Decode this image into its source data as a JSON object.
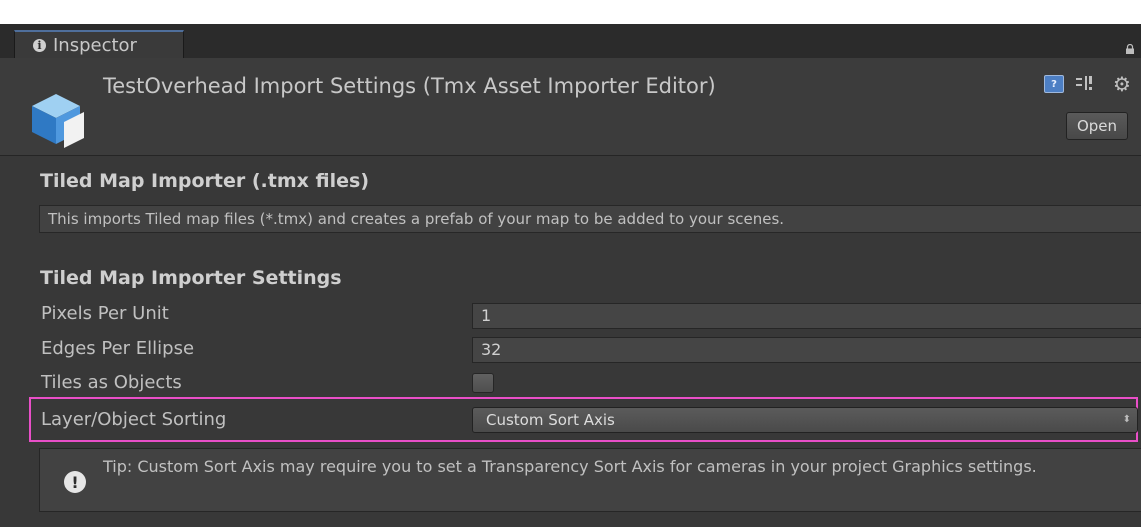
{
  "tab": {
    "label": "Inspector",
    "info_icon": "i"
  },
  "header": {
    "title": "TestOverhead Import Settings (Tmx Asset Importer Editor)",
    "open_label": "Open",
    "help_icon_glyph": "?"
  },
  "importer": {
    "title": "Tiled Map Importer (.tmx files)",
    "description": "This imports Tiled map files (*.tmx) and creates a prefab of your map to be added to your scenes."
  },
  "settings": {
    "title": "Tiled Map Importer Settings",
    "pixels_per_unit": {
      "label": "Pixels Per Unit",
      "value": "1"
    },
    "edges_per_ellipse": {
      "label": "Edges Per Ellipse",
      "value": "32"
    },
    "tiles_as_objects": {
      "label": "Tiles as Objects",
      "checked": false
    },
    "layer_sorting": {
      "label": "Layer/Object Sorting",
      "value": "Custom Sort Axis",
      "arrows": "⬍"
    }
  },
  "tip": {
    "icon": "!",
    "text": "Tip: Custom Sort Axis may require you to set a Transparency Sort Axis for cameras in your project Graphics settings."
  },
  "colors": {
    "highlight": "#e94fc8",
    "tab_accent": "#4f6f9c"
  }
}
